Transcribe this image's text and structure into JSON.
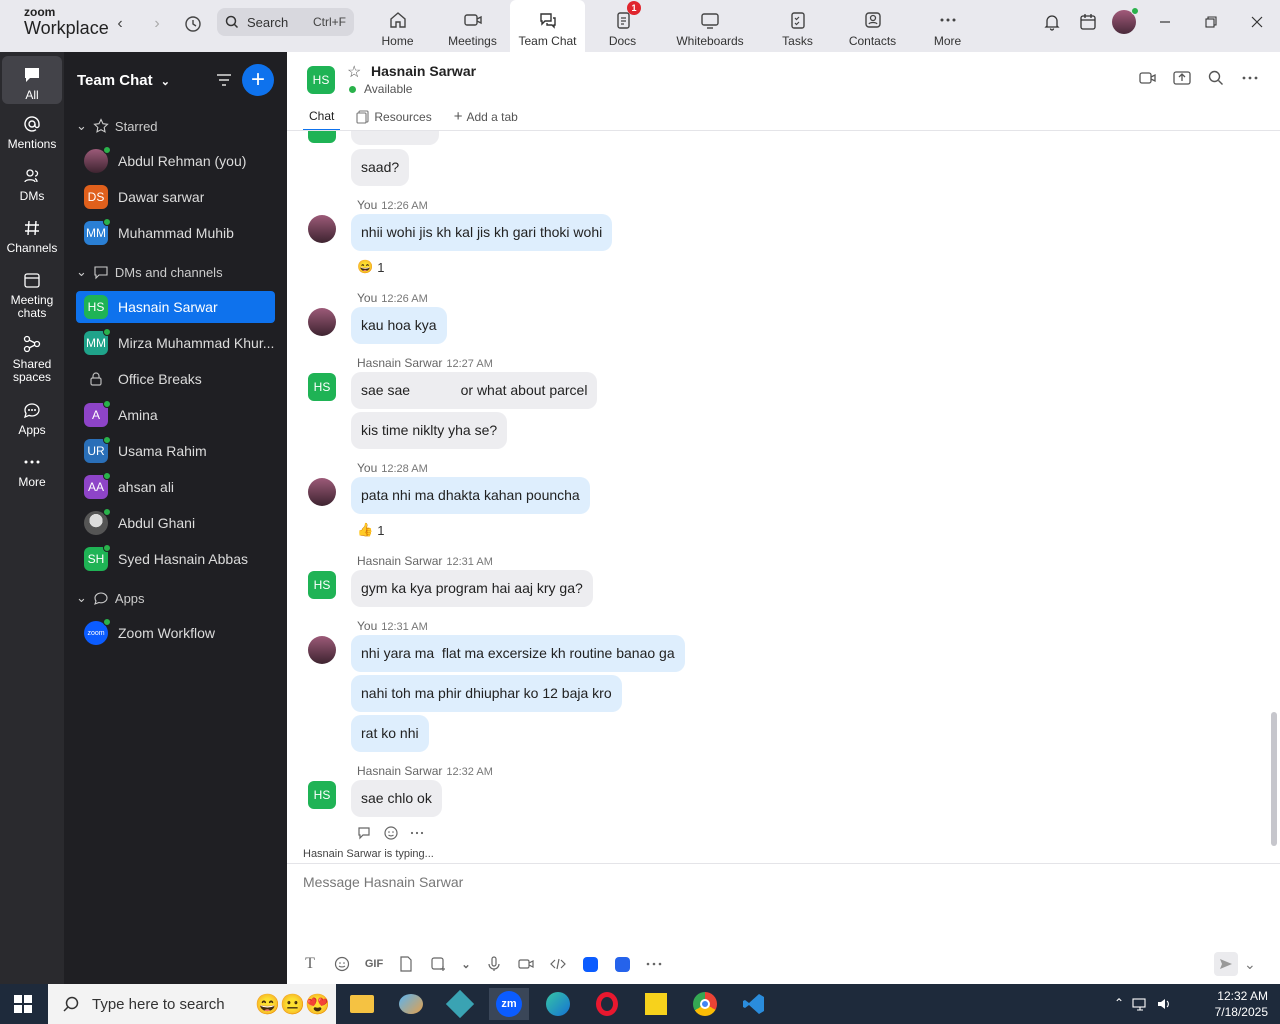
{
  "app": {
    "brand_top": "zoom",
    "brand_bottom": "Workplace"
  },
  "search": {
    "label": "Search",
    "shortcut": "Ctrl+F"
  },
  "tabs": [
    {
      "label": "Home",
      "icon": "home-icon"
    },
    {
      "label": "Meetings",
      "icon": "meetings-icon"
    },
    {
      "label": "Team Chat",
      "icon": "team-chat-icon",
      "active": true
    },
    {
      "label": "Docs",
      "icon": "docs-icon",
      "badge": "1"
    },
    {
      "label": "Whiteboards",
      "icon": "whiteboard-icon"
    },
    {
      "label": "Tasks",
      "icon": "tasks-icon"
    },
    {
      "label": "Contacts",
      "icon": "contacts-icon"
    },
    {
      "label": "More",
      "icon": "more-icon"
    }
  ],
  "rail": [
    {
      "label": "All",
      "icon": "chat-bubble-icon"
    },
    {
      "label": "Mentions",
      "icon": "at-icon"
    },
    {
      "label": "DMs",
      "icon": "people-icon"
    },
    {
      "label": "Channels",
      "icon": "hash-icon"
    },
    {
      "label": "Meeting chats",
      "icon": "calendar-icon"
    },
    {
      "label": "Shared spaces",
      "icon": "share-icon"
    },
    {
      "label": "Apps",
      "icon": "apps-icon"
    },
    {
      "label": "More",
      "icon": "more-icon"
    }
  ],
  "sidebar": {
    "title": "Team Chat",
    "starred_label": "Starred",
    "starred": [
      {
        "name": "Abdul Rehman (you)",
        "initials": "",
        "color": "#8a4a63"
      },
      {
        "name": "Dawar sarwar",
        "initials": "DS",
        "color": "#e0601c"
      },
      {
        "name": "Muhammad Muhib",
        "initials": "MM",
        "color": "#2a7fd4"
      }
    ],
    "dms_label": "DMs and channels",
    "dms": [
      {
        "name": "Hasnain Sarwar",
        "initials": "HS",
        "color": "#1fb355",
        "active": true
      },
      {
        "name": "Mirza Muhammad Khur...",
        "initials": "MM",
        "color": "#1fa38a"
      },
      {
        "name": "Office Breaks",
        "initials": "",
        "color": ""
      },
      {
        "name": "Amina",
        "initials": "A",
        "color": "#8e44c8"
      },
      {
        "name": "Usama Rahim",
        "initials": "UR",
        "color": "#2a6fb8"
      },
      {
        "name": "ahsan ali",
        "initials": "AA",
        "color": "#8e44c8"
      },
      {
        "name": "Abdul Ghani",
        "initials": "",
        "color": ""
      },
      {
        "name": "Syed Hasnain Abbas",
        "initials": "SH",
        "color": "#1fb355"
      }
    ],
    "apps_label": "Apps",
    "apps": [
      {
        "name": "Zoom Workflow",
        "initials": "zoom",
        "color": "#0b5cff"
      }
    ]
  },
  "header": {
    "initials": "HS",
    "name": "Hasnain Sarwar",
    "status": "Available"
  },
  "subtabs": {
    "chat": "Chat",
    "resources": "Resources",
    "add": "Add a tab"
  },
  "messages": {
    "m0": {
      "text": "saad?"
    },
    "m1": {
      "sender": "You",
      "time": "12:26 AM",
      "text": "nhii wohi jis kh kal jis kh gari thoki wohi",
      "reaction": "😄",
      "count": "1"
    },
    "m2": {
      "sender": "You",
      "time": "12:26 AM",
      "text": "kau hoa kya"
    },
    "m3": {
      "sender": "Hasnain Sarwar",
      "time": "12:27 AM",
      "text": "sae sae             or what about parcel",
      "text2": "kis time niklty yha se?"
    },
    "m4": {
      "sender": "You",
      "time": "12:28 AM",
      "text": "pata nhi ma dhakta kahan pouncha",
      "reaction": "👍",
      "count": "1"
    },
    "m5": {
      "sender": "Hasnain Sarwar",
      "time": "12:31 AM",
      "text": "gym ka kya program hai aaj kry ga?"
    },
    "m6": {
      "sender": "You",
      "time": "12:31 AM",
      "text": "nhi yara ma  flat ma excersize kh routine banao ga",
      "text2": "nahi toh ma phir dhiuphar ko 12 baja kro",
      "text3": "rat ko nhi"
    },
    "m7": {
      "sender": "Hasnain Sarwar",
      "time": "12:32 AM",
      "text": "sae chlo ok"
    }
  },
  "typing": "Hasnain Sarwar  is typing...",
  "composer": {
    "placeholder": "Message Hasnain Sarwar"
  },
  "toolbar": {
    "gif": "GIF"
  },
  "taskbar": {
    "search_placeholder": "Type here to search",
    "time": "12:32 AM",
    "date": "7/18/2025"
  },
  "colors": {
    "accent": "#0e72ed",
    "my_bubble": "#deeefd",
    "their_bubble": "#ededf0",
    "sidebar_bg": "#1f1f23",
    "rail_bg": "#2a2a2e"
  }
}
